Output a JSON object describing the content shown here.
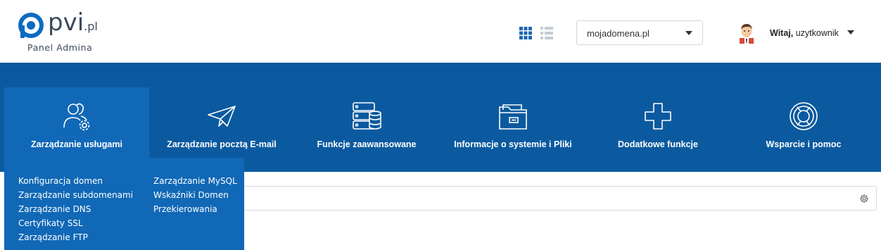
{
  "header": {
    "logo_text": "pvi",
    "logo_tld": ".pl",
    "logo_subtitle": "Panel Admina",
    "view_toggle": {
      "grid_icon": "grid-icon",
      "list_icon": "list-icon"
    },
    "domain_select": {
      "value": "mojadomena.pl"
    },
    "user": {
      "greeting": "Witaj,",
      "name": "uzytkownik"
    }
  },
  "nav": {
    "items": [
      {
        "label": "Zarządzanie usługami",
        "icon": "users-gear-icon"
      },
      {
        "label": "Zarządzanie pocztą E-mail",
        "icon": "paper-plane-icon"
      },
      {
        "label": "Funkcje zaawansowane",
        "icon": "database-icon"
      },
      {
        "label": "Informacje o systemie i Pliki",
        "icon": "folder-icon"
      },
      {
        "label": "Dodatkowe funkcje",
        "icon": "plus-icon"
      },
      {
        "label": "Wsparcie i pomoc",
        "icon": "lifebuoy-icon"
      }
    ]
  },
  "dropdown": {
    "col1": [
      "Konfiguracja domen",
      "Zarządzanie subdomenami",
      "Zarządzanie DNS",
      "Certyfikaty SSL",
      "Zarządzanie FTP"
    ],
    "col2": [
      "Zarządzanie MySQL",
      "Wskaźniki Domen",
      "Przekierowania"
    ]
  },
  "colors": {
    "nav_bg": "#0b5a9f",
    "nav_active": "#1168b6",
    "logo": "#3b4a5a"
  }
}
